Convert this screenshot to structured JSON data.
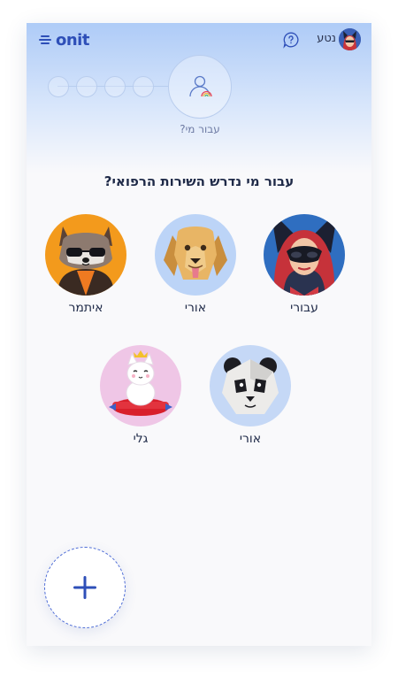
{
  "header": {
    "logo_text": "onit",
    "user_name": "נטע"
  },
  "stepper": {
    "current_label": "עבור מי?"
  },
  "main": {
    "question": "עבור מי נדרש השירות הרפואי?",
    "profiles": [
      {
        "name": "עבורי",
        "avatar": "catwoman-avatar"
      },
      {
        "name": "אורי",
        "avatar": "golden-dog-avatar"
      },
      {
        "name": "איתמר",
        "avatar": "raccoon-avatar"
      },
      {
        "name": "אורי",
        "avatar": "panda-avatar"
      },
      {
        "name": "גלי",
        "avatar": "white-cat-avatar"
      }
    ],
    "add_button_icon": "plus-icon"
  },
  "colors": {
    "brand": "#2e4fb8",
    "accent": "#4c6bd6",
    "header_gradient_top": "#aecbf7",
    "text_primary": "#1f2a48"
  }
}
